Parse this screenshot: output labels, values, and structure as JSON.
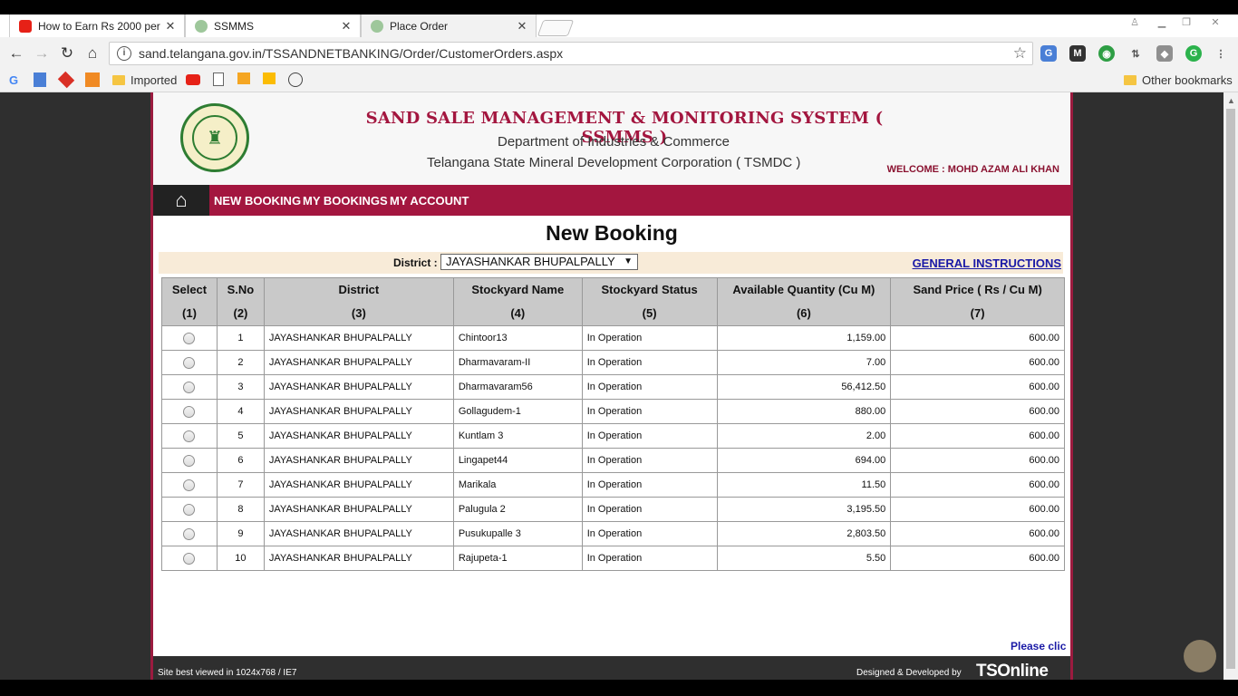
{
  "browser": {
    "tabs": [
      {
        "label": "How to Earn Rs 2000 per",
        "icon": "youtube-icon",
        "active": false
      },
      {
        "label": "SSMMS",
        "icon": "site-icon",
        "active": false
      },
      {
        "label": "Place Order",
        "icon": "site-icon",
        "active": true
      }
    ],
    "tab_close": "✕",
    "url": "sand.telangana.gov.in/TSSANDNETBANKING/Order/CustomerOrders.aspx",
    "bookmarks": {
      "imported": "Imported",
      "other": "Other bookmarks"
    }
  },
  "header": {
    "title": "SAND SALE MANAGEMENT & MONITORING SYSTEM ( SSMMS )",
    "subtitle1": "Department of Industries & Commerce",
    "subtitle2": "Telangana State Mineral Development Corporation ( TSMDC )",
    "welcome": "WELCOME : MOHD AZAM ALI KHAN"
  },
  "menu": {
    "items": [
      "NEW BOOKING",
      "MY BOOKINGS",
      "MY ACCOUNT"
    ]
  },
  "page": {
    "title": "New Booking",
    "district_label": "District :",
    "district_value": "JAYASHANKAR BHUPALPALLY",
    "instructions_link": "GENERAL INSTRUCTIONS",
    "please_click": "Please clic"
  },
  "table": {
    "columns": [
      {
        "name": "Select",
        "num": "(1)"
      },
      {
        "name": "S.No",
        "num": "(2)"
      },
      {
        "name": "District",
        "num": "(3)"
      },
      {
        "name": "Stockyard Name",
        "num": "(4)"
      },
      {
        "name": "Stockyard Status",
        "num": "(5)"
      },
      {
        "name": "Available Quantity (Cu M)",
        "num": "(6)"
      },
      {
        "name": "Sand Price ( Rs / Cu M)",
        "num": "(7)"
      }
    ],
    "rows": [
      {
        "sno": "1",
        "district": "JAYASHANKAR BHUPALPALLY",
        "stockyard": "Chintoor13",
        "status": "In Operation",
        "qty": "1,159.00",
        "price": "600.00"
      },
      {
        "sno": "2",
        "district": "JAYASHANKAR BHUPALPALLY",
        "stockyard": "Dharmavaram-II",
        "status": "In Operation",
        "qty": "7.00",
        "price": "600.00"
      },
      {
        "sno": "3",
        "district": "JAYASHANKAR BHUPALPALLY",
        "stockyard": "Dharmavaram56",
        "status": "In Operation",
        "qty": "56,412.50",
        "price": "600.00"
      },
      {
        "sno": "4",
        "district": "JAYASHANKAR BHUPALPALLY",
        "stockyard": "Gollagudem-1",
        "status": "In Operation",
        "qty": "880.00",
        "price": "600.00"
      },
      {
        "sno": "5",
        "district": "JAYASHANKAR BHUPALPALLY",
        "stockyard": "Kuntlam 3",
        "status": "In Operation",
        "qty": "2.00",
        "price": "600.00"
      },
      {
        "sno": "6",
        "district": "JAYASHANKAR BHUPALPALLY",
        "stockyard": "Lingapet44",
        "status": "In Operation",
        "qty": "694.00",
        "price": "600.00"
      },
      {
        "sno": "7",
        "district": "JAYASHANKAR BHUPALPALLY",
        "stockyard": "Marikala",
        "status": "In Operation",
        "qty": "11.50",
        "price": "600.00"
      },
      {
        "sno": "8",
        "district": "JAYASHANKAR BHUPALPALLY",
        "stockyard": "Palugula 2",
        "status": "In Operation",
        "qty": "3,195.50",
        "price": "600.00"
      },
      {
        "sno": "9",
        "district": "JAYASHANKAR BHUPALPALLY",
        "stockyard": "Pusukupalle 3",
        "status": "In Operation",
        "qty": "2,803.50",
        "price": "600.00"
      },
      {
        "sno": "10",
        "district": "JAYASHANKAR BHUPALPALLY",
        "stockyard": "Rajupeta-1",
        "status": "In Operation",
        "qty": "5.50",
        "price": "600.00"
      }
    ]
  },
  "footer": {
    "left": "Site best viewed in 1024x768 / IE7",
    "right": "Designed & Developed by",
    "logo": "TSOnline"
  },
  "colors": {
    "brand": "#a3163f",
    "header_bg": "#c9c9c9",
    "link": "#1a1aa6"
  }
}
